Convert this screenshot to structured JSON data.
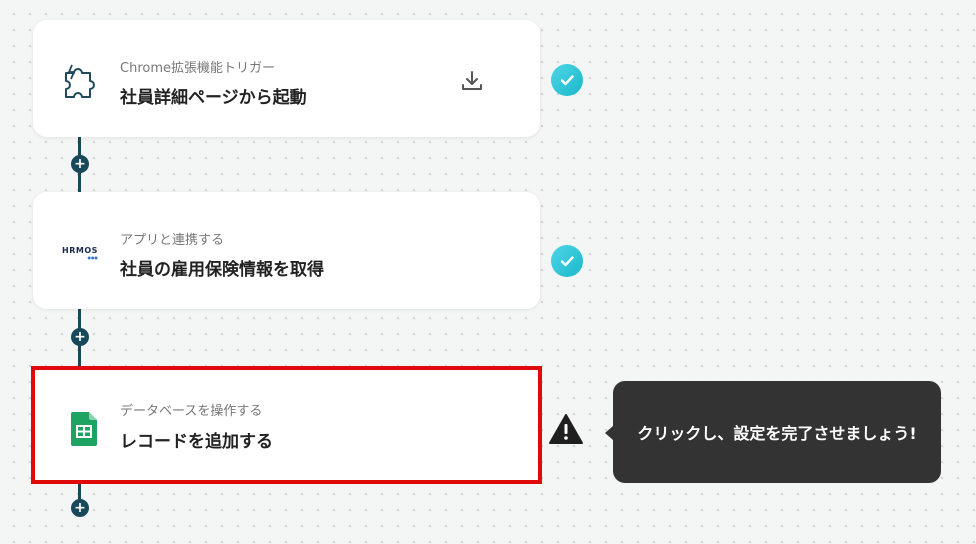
{
  "flow": {
    "steps": [
      {
        "subtitle": "Chrome拡張機能トリガー",
        "title": "社員詳細ページから起動",
        "icon": "chrome-extension-puzzle-icon",
        "status": "done"
      },
      {
        "subtitle": "アプリと連携する",
        "title": "社員の雇用保険情報を取得",
        "icon": "hrmos-logo",
        "logo_text": "HRMOS",
        "status": "done"
      },
      {
        "subtitle": "データベースを操作する",
        "title": "レコードを追加する",
        "icon": "google-sheets-icon",
        "status": "warning"
      }
    ],
    "add_step_label": "+"
  },
  "tooltip": {
    "text": "クリックし、設定を完了させましょう!"
  },
  "colors": {
    "connector": "#18495a",
    "check_gradient_start": "#4fd6e8",
    "check_gradient_end": "#19b8c9",
    "selected_border": "#e10a0a",
    "tooltip_bg": "#333333"
  }
}
